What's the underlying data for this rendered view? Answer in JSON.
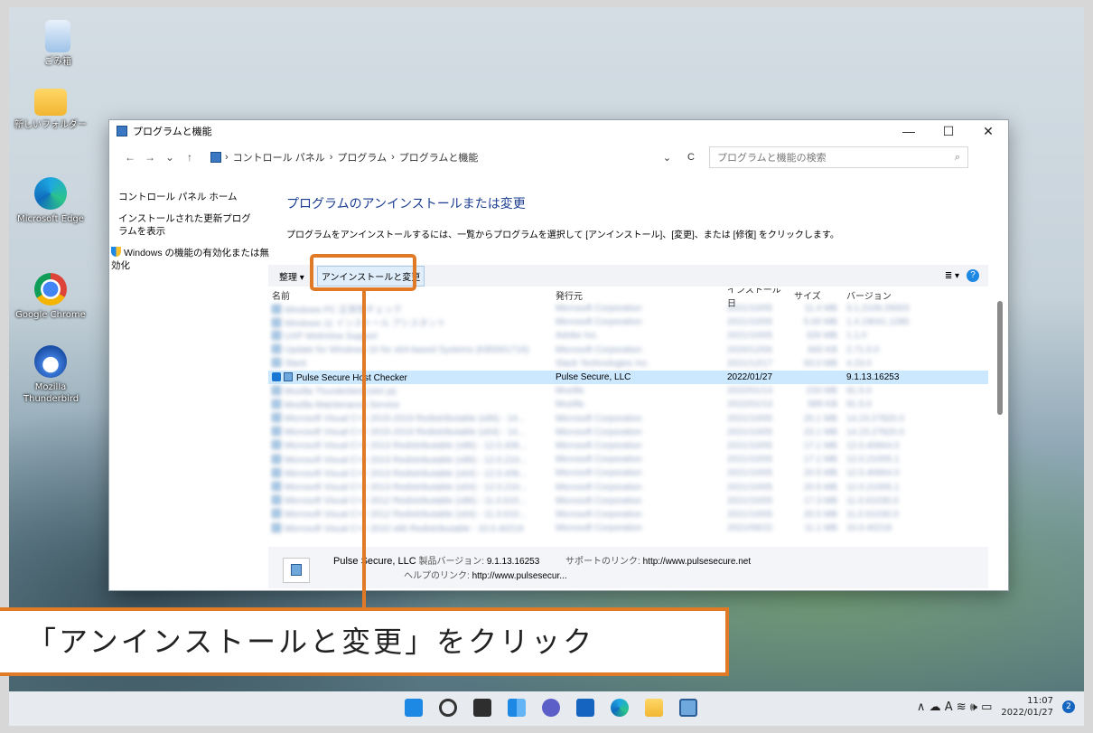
{
  "desktop": {
    "icons": [
      {
        "label": "ごみ箱"
      },
      {
        "label": "新しいフォルダー"
      },
      {
        "label": "Microsoft Edge"
      },
      {
        "label": "Google Chrome"
      },
      {
        "label": "Mozilla Thunderbird"
      }
    ]
  },
  "window": {
    "title": "プログラムと機能",
    "controls": {
      "minimize": "—",
      "maximize": "☐",
      "close": "✕"
    },
    "nav": {
      "back": "←",
      "forward": "→",
      "recent": "⌄",
      "up": "↑",
      "refresh": "C",
      "dropdown": "⌄"
    },
    "breadcrumb": [
      "›",
      "コントロール パネル",
      "›",
      "プログラム",
      "›",
      "プログラムと機能"
    ],
    "search_placeholder": "プログラムと機能の検索",
    "search_icon": "⌕",
    "leftnav": [
      "コントロール パネル ホーム",
      "インストールされた更新プログラムを表示",
      "Windows の機能の有効化または無効化"
    ],
    "heading": "プログラムのアンインストールまたは変更",
    "description": "プログラムをアンインストールするには、一覧からプログラムを選択して [アンインストール]、[変更]、または [修復] をクリックします。",
    "toolbar": {
      "organize": "整理 ▾",
      "uninstall": "アンインストールと変更",
      "view": "≣ ▾",
      "help": "?"
    },
    "columns": [
      "名前",
      "発行元",
      "インストール日",
      "サイズ",
      "バージョン"
    ],
    "rows": [
      {
        "name": "Windows PC 正常性チェック",
        "publisher": "Microsoft Corporation",
        "date": "2021/10/05",
        "size": "11.4 MB",
        "version": "3.1.2109.29003"
      },
      {
        "name": "Windows 11 インストール アシスタント",
        "publisher": "Microsoft Corporation",
        "date": "2021/10/05",
        "size": "5.00 MB",
        "version": "1.4.19041.1285"
      },
      {
        "name": "UXP WebView Support",
        "publisher": "Adobe Inc.",
        "date": "2021/10/05",
        "size": "326 MB",
        "version": "1.1.0"
      },
      {
        "name": "Update for Windows 10 for x64-based Systems (KB5001716)",
        "publisher": "Microsoft Corporation",
        "date": "2020/12/06",
        "size": "600 KB",
        "version": "2.71.0.0"
      },
      {
        "name": "Slack",
        "publisher": "Slack Technologies Inc.",
        "date": "2021/12/17",
        "size": "93.0 MB",
        "version": "4.23.0"
      },
      {
        "name": "Pulse Secure Host Checker",
        "publisher": "Pulse Secure, LLC",
        "date": "2022/01/27",
        "size": "",
        "version": "9.1.13.16253"
      },
      {
        "name": "Mozilla Thunderbird (x64 ja)",
        "publisher": "Mozilla",
        "date": "2022/01/13",
        "size": "233 MB",
        "version": "91.5.0"
      },
      {
        "name": "Mozilla Maintenance Service",
        "publisher": "Mozilla",
        "date": "2022/01/13",
        "size": "589 KB",
        "version": "91.5.0"
      },
      {
        "name": "Microsoft Visual C++ 2015-2019 Redistributable (x86) - 14...",
        "publisher": "Microsoft Corporation",
        "date": "2021/10/05",
        "size": "20.1 MB",
        "version": "14.23.27820.0"
      },
      {
        "name": "Microsoft Visual C++ 2015-2019 Redistributable (x64) - 14...",
        "publisher": "Microsoft Corporation",
        "date": "2021/10/05",
        "size": "23.1 MB",
        "version": "14.23.27820.0"
      },
      {
        "name": "Microsoft Visual C++ 2013 Redistributable (x86) - 12.0.406...",
        "publisher": "Microsoft Corporation",
        "date": "2021/10/05",
        "size": "17.1 MB",
        "version": "12.0.40664.0"
      },
      {
        "name": "Microsoft Visual C++ 2013 Redistributable (x86) - 12.0.210...",
        "publisher": "Microsoft Corporation",
        "date": "2021/10/05",
        "size": "17.1 MB",
        "version": "12.0.21005.1"
      },
      {
        "name": "Microsoft Visual C++ 2013 Redistributable (x64) - 12.0.406...",
        "publisher": "Microsoft Corporation",
        "date": "2021/10/05",
        "size": "20.5 MB",
        "version": "12.0.40664.0"
      },
      {
        "name": "Microsoft Visual C++ 2013 Redistributable (x64) - 12.0.210...",
        "publisher": "Microsoft Corporation",
        "date": "2021/10/05",
        "size": "20.5 MB",
        "version": "12.0.21005.1"
      },
      {
        "name": "Microsoft Visual C++ 2012 Redistributable (x86) - 11.0.610...",
        "publisher": "Microsoft Corporation",
        "date": "2021/10/05",
        "size": "17.3 MB",
        "version": "11.0.61030.0"
      },
      {
        "name": "Microsoft Visual C++ 2012 Redistributable (x64) - 11.0.610...",
        "publisher": "Microsoft Corporation",
        "date": "2021/10/05",
        "size": "20.5 MB",
        "version": "11.0.61030.0"
      },
      {
        "name": "Microsoft Visual C++ 2010 x86 Redistributable - 10.0.40219",
        "publisher": "Microsoft Corporation",
        "date": "2021/09/22",
        "size": "11.1 MB",
        "version": "10.0.40219"
      }
    ],
    "details": {
      "publisher": "Pulse Secure, LLC",
      "version_label": "製品バージョン:",
      "version": "9.1.13.16253",
      "support_label": "サポートのリンク:",
      "support": "http://www.pulsesecure.net",
      "help_label": "ヘルプのリンク:",
      "help": "http://www.pulsesecur..."
    }
  },
  "callout": {
    "text": "「アンインストールと変更」をクリック"
  },
  "taskbar": {
    "tray_icons": "∧  ☁  A  ≋ 🕪 ▭",
    "time": "11:07",
    "date": "2022/01/27",
    "badge": "2"
  },
  "colors": {
    "accent": "#e07a27",
    "link": "#1b3d91",
    "selection": "#cce8ff"
  }
}
